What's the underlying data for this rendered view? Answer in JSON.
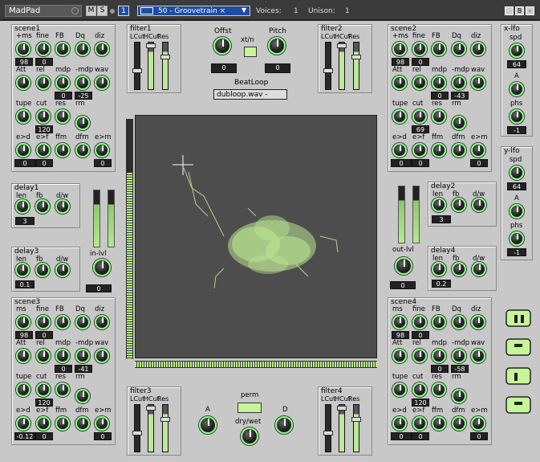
{
  "header": {
    "title": "MadPad",
    "m_label": "M",
    "s_label": "S",
    "channel": "1",
    "preset": "50 - Groovetrain",
    "preset_close": "×",
    "voices_label": "Voices:",
    "voices_value": "1",
    "unison_label": "Unison:",
    "unison_value": "1",
    "btn_min": "",
    "btn_b": "B",
    "btn_close": "-"
  },
  "scene1": {
    "title": "scene1",
    "row1": [
      "+ms",
      "fine",
      "FB",
      "Dq",
      "diz"
    ],
    "row1_vals": [
      "98",
      "0"
    ],
    "row2": [
      "Att",
      "rel",
      "mdp",
      "-mdp",
      "wav"
    ],
    "row2_vals": [
      "0",
      "-25"
    ],
    "row3": [
      "tupe",
      "cut",
      "res",
      "rm"
    ],
    "row3_vals": [
      "120"
    ],
    "row4": [
      "e>d",
      "e>f",
      "ffm",
      "dfm",
      "e>m"
    ],
    "row4_vals": [
      "0",
      "0",
      "0"
    ]
  },
  "scene2": {
    "title": "scene2",
    "row1": [
      "+ms",
      "fine",
      "FB",
      "Dq",
      "diz"
    ],
    "row1_vals": [
      "98",
      "0"
    ],
    "row2": [
      "Att",
      "rel",
      "mdp",
      "-mdp",
      "wav"
    ],
    "row2_vals": [
      "0",
      "-43"
    ],
    "row3": [
      "tupe",
      "cut",
      "res",
      "rm"
    ],
    "row3_vals": [
      "69"
    ],
    "row4": [
      "e>d",
      "e>f",
      "ffm",
      "dfm",
      "e>m"
    ],
    "row4_vals": [
      "0",
      "0",
      "0"
    ]
  },
  "scene3": {
    "title": "scene3",
    "row1": [
      "ms",
      "fine",
      "FB",
      "Dq",
      "diz"
    ],
    "row1_vals": [
      "98",
      "0"
    ],
    "row2": [
      "Att",
      "rel",
      "mdp",
      "-mdp",
      "wav"
    ],
    "row2_vals": [
      "0",
      "-41"
    ],
    "row3": [
      "tupe",
      "cut",
      "res",
      "rm"
    ],
    "row3_vals": [
      "120"
    ],
    "row4": [
      "e>d",
      "e>f",
      "ffm",
      "dfm",
      "e>m"
    ],
    "row4_vals": [
      "-0.12",
      "0",
      "0"
    ]
  },
  "scene4": {
    "title": "scene4",
    "row1": [
      "ms",
      "fine",
      "FB",
      "Dq",
      "diz"
    ],
    "row1_vals": [
      "98",
      "0"
    ],
    "row2": [
      "Att",
      "rel",
      "mdp",
      "-mdp",
      "wav"
    ],
    "row2_vals": [
      "0",
      "-58"
    ],
    "row3": [
      "tupe",
      "cut",
      "res",
      "rm"
    ],
    "row3_vals": [
      "120"
    ],
    "row4": [
      "e>d",
      "e>f",
      "ffm",
      "dfm",
      "e>m"
    ],
    "row4_vals": [
      "0",
      "0",
      "0"
    ]
  },
  "filters": {
    "filter1": "filter1",
    "filter2": "filter2",
    "filter3": "filter3",
    "filter4": "filter4",
    "cols": [
      "LCut",
      "HCut",
      "Res"
    ]
  },
  "delay1": {
    "title": "delay1",
    "labels": [
      "len",
      "fb",
      "d/w"
    ],
    "value": "3"
  },
  "delay2": {
    "title": "delay2",
    "labels": [
      "len",
      "fb",
      "d/w"
    ],
    "value": "3"
  },
  "delay3": {
    "title": "delay3",
    "labels": [
      "len",
      "fb",
      "d/w"
    ],
    "value": "0.1"
  },
  "delay4": {
    "title": "delay4",
    "labels": [
      "len",
      "fb",
      "d/w"
    ],
    "value": "0.2"
  },
  "in_lvl": {
    "label": "in-lvl",
    "value": "0"
  },
  "out_lvl": {
    "label": "out-lvl",
    "value": "0"
  },
  "center": {
    "offst_label": "Offst",
    "offst_value": "0",
    "xtn_label": "xt/n",
    "pitch_label": "Pitch",
    "pitch_value": "0",
    "beatloop_label": "BeatLoop",
    "beatloop_file": "dubloop.wav -"
  },
  "bottom": {
    "a_label": "A",
    "perm_label": "perm",
    "drywet_label": "dry/wet",
    "d_label": "D"
  },
  "xlfo": {
    "title": "x-lfo",
    "labels": [
      "spd",
      "A",
      "phs"
    ],
    "spd_value": "64",
    "phs_value": "-1"
  },
  "ylfo": {
    "title": "y-lfo",
    "labels": [
      "spd",
      "A",
      "phs"
    ],
    "spd_value": "64",
    "phs_value": "-1"
  },
  "colors": {
    "accent": "#c6f59a",
    "panel": "#c8c8c8",
    "pad": "#4d4d4d"
  }
}
